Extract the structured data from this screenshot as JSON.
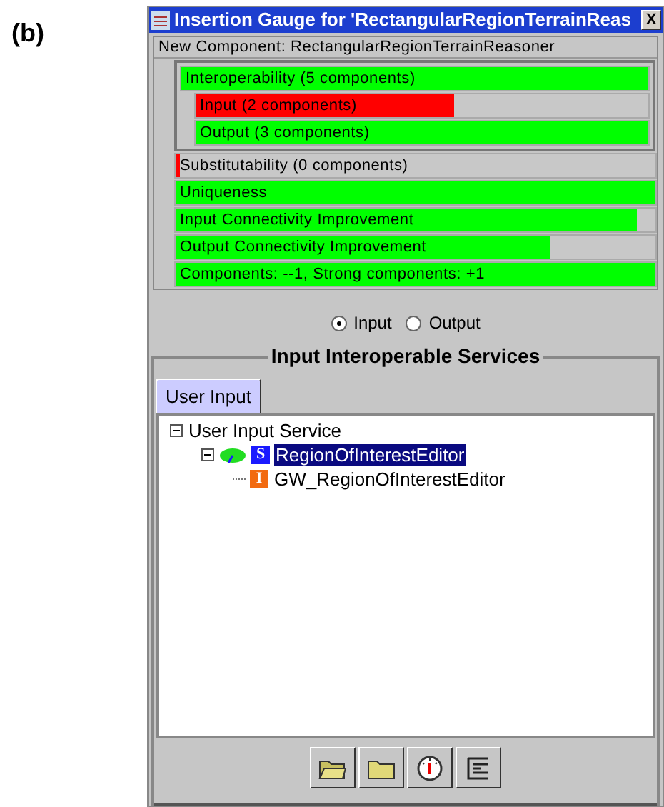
{
  "figure_label": "(b)",
  "window": {
    "title": "Insertion Gauge for 'RectangularRegionTerrainReas",
    "close": "X"
  },
  "gauges": {
    "header": "New Component: RectangularRegionTerrainReasoner",
    "bars": [
      {
        "label": "Interoperability (5 components)",
        "level": 1,
        "color": "#00ff00",
        "children": [
          {
            "label": "Input (2 components)",
            "level": 0.57,
            "color": "#ff0000"
          },
          {
            "label": "Output (3 components)",
            "level": 1,
            "color": "#00ff00"
          }
        ]
      },
      {
        "label": "Substitutability (0 components)",
        "level": 0.01,
        "color": "#ff0000"
      },
      {
        "label": "Uniqueness",
        "level": 1,
        "color": "#00ff00"
      },
      {
        "label": "Input Connectivity Improvement",
        "level": 0.96,
        "color": "#00ff00"
      },
      {
        "label": "Output Connectivity Improvement",
        "level": 0.78,
        "color": "#00ff00"
      },
      {
        "label": "Components: --1, Strong components: +1",
        "level": 1,
        "color": "#00ff00"
      }
    ]
  },
  "direction": [
    {
      "label": "Input",
      "selected": true
    },
    {
      "label": "Output",
      "selected": false
    }
  ],
  "services": {
    "title": "Input Interoperable Services",
    "tabs": [
      {
        "label": "User Input",
        "selected": true
      }
    ],
    "tree": [
      {
        "label": "User Input Service",
        "expanded": true,
        "selected": false,
        "children": [
          {
            "label": "RegionOfInterestEditor",
            "kind": "service",
            "badge": "S",
            "expanded": true,
            "selected": true,
            "children": [
              {
                "label": "GW_RegionOfInterestEditor",
                "kind": "interface",
                "badge": "I",
                "selected": false
              }
            ]
          }
        ]
      }
    ]
  },
  "toolbar": [
    {
      "kind": "open-folder"
    },
    {
      "kind": "folder"
    },
    {
      "kind": "gauge"
    },
    {
      "kind": "list"
    }
  ]
}
